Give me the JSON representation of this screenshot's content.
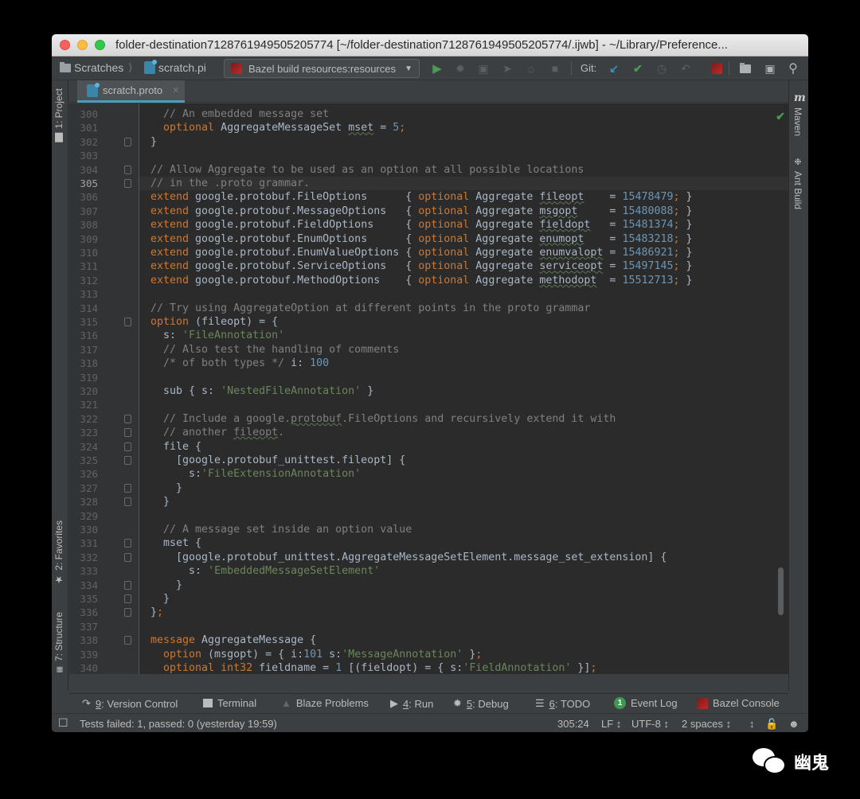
{
  "window": {
    "title": "folder-destination7128761949505205774 [~/folder-destination7128761949505205774/.ijwb] - ~/Library/Preference..."
  },
  "navbar": {
    "breadcrumb": [
      "Scratches",
      "scratch.pi"
    ],
    "run_config": "Bazel build resources:resources",
    "git_label": "Git:",
    "icons": [
      "run-icon",
      "debug-icon",
      "coverage-icon",
      "profile-icon",
      "bug-icon",
      "stop-icon",
      "git-update-icon",
      "git-commit-icon",
      "history-icon",
      "rollback-icon",
      "bazel-sync-icon",
      "project-structure-icon",
      "terminal-window-icon",
      "search-icon"
    ]
  },
  "left_tools": {
    "project": "1: Project",
    "favorites": "2: Favorites",
    "structure": "7: Structure"
  },
  "right_tools": {
    "maven": "Maven",
    "ant": "Ant Build"
  },
  "editor": {
    "tab_label": "scratch.proto",
    "current_line": 305,
    "lines": [
      {
        "n": "300",
        "fold": false
      },
      {
        "n": "301",
        "fold": false
      },
      {
        "n": "302",
        "fold": true
      },
      {
        "n": "303",
        "fold": false
      },
      {
        "n": "304",
        "fold": true
      },
      {
        "n": "305",
        "fold": true
      },
      {
        "n": "306"
      },
      {
        "n": "307"
      },
      {
        "n": "308"
      },
      {
        "n": "309"
      },
      {
        "n": "310"
      },
      {
        "n": "311"
      },
      {
        "n": "312"
      },
      {
        "n": "313"
      },
      {
        "n": "314"
      },
      {
        "n": "315"
      },
      {
        "n": "316"
      },
      {
        "n": "317"
      },
      {
        "n": "318"
      },
      {
        "n": "319"
      },
      {
        "n": "320"
      },
      {
        "n": "321"
      },
      {
        "n": "322"
      },
      {
        "n": "323"
      },
      {
        "n": "324"
      },
      {
        "n": "325"
      },
      {
        "n": "326"
      },
      {
        "n": "327"
      },
      {
        "n": "328"
      },
      {
        "n": "329"
      },
      {
        "n": "330"
      },
      {
        "n": "331"
      },
      {
        "n": "332"
      },
      {
        "n": "333"
      },
      {
        "n": "334"
      },
      {
        "n": "335"
      },
      {
        "n": "336"
      },
      {
        "n": "337"
      },
      {
        "n": "338"
      },
      {
        "n": "339"
      },
      {
        "n": "340"
      }
    ],
    "code": {
      "l300": "// An embedded message set",
      "l301_kw": "optional",
      "l301_type": " AggregateMessageSet ",
      "l301_field": "mset",
      "l301_eq": " = ",
      "l301_num": "5",
      "l302": "}",
      "l304": "// Allow Aggregate to be used as an option at all possible locations",
      "l305": "// in the .proto grammar.",
      "extends": [
        {
          "target": "google.protobuf.FileOptions      ",
          "field": "fileopt",
          "pad": "    ",
          "num": "15478479"
        },
        {
          "target": "google.protobuf.MessageOptions   ",
          "field": "msgopt",
          "pad": "     ",
          "num": "15480088"
        },
        {
          "target": "google.protobuf.FieldOptions     ",
          "field": "fieldopt",
          "pad": "   ",
          "num": "15481374"
        },
        {
          "target": "google.protobuf.EnumOptions      ",
          "field": "enumopt",
          "pad": "    ",
          "num": "15483218"
        },
        {
          "target": "google.protobuf.EnumValueOptions ",
          "field": "enumvalopt",
          "pad": " ",
          "num": "15486921"
        },
        {
          "target": "google.protobuf.ServiceOptions   ",
          "field": "serviceopt",
          "pad": " ",
          "num": "15497145"
        },
        {
          "target": "google.protobuf.MethodOptions    ",
          "field": "methodopt",
          "pad": "  ",
          "num": "15512713"
        }
      ],
      "extend_kw": "extend",
      "optional_kw": "optional",
      "aggregate": " Aggregate ",
      "l314": "// Try using AggregateOption at different points in the proto grammar",
      "l315_kw": "option",
      "l315_rest": " (fileopt) = {",
      "l316_key": "  s: ",
      "l316_str": "'FileAnnotation'",
      "l317": "  // Also test the handling of comments",
      "l318_c": "  /* of both types */",
      "l318_key": " i: ",
      "l318_num": "100",
      "l320_pre": "  sub { s: ",
      "l320_str": "'NestedFileAnnotation'",
      "l320_post": " }",
      "l322_a": "  // Include a google.",
      "l322_u": "protobuf",
      "l322_b": ".FileOptions and recursively extend it with",
      "l323_a": "  // another ",
      "l323_u": "fileopt",
      "l323_b": ".",
      "l324": "  file {",
      "l325": "    [google.protobuf_unittest.fileopt] {",
      "l326_key": "      s:",
      "l326_str": "'FileExtensionAnnotation'",
      "l327": "    }",
      "l328": "  }",
      "l330": "  // A message set inside an option value",
      "l331": "  mset {",
      "l332": "    [google.protobuf_unittest.AggregateMessageSetElement.message_set_extension] {",
      "l333_key": "      s: ",
      "l333_str": "'EmbeddedMessageSetElement'",
      "l334": "    }",
      "l335": "  }",
      "l336": "};",
      "l338_kw": "message",
      "l338_rest": " AggregateMessage {",
      "l339_kw": "  option",
      "l339_a": " (msgopt) = { i:",
      "l339_num": "101",
      "l339_b": " s:",
      "l339_str": "'MessageAnnotation'",
      "l339_c": " };",
      "l340_kw": "  optional",
      "l340_kw2": " int32",
      "l340_a": " fieldname = ",
      "l340_num": "1",
      "l340_b": " [(fieldopt) = { s:",
      "l340_str": "'FieldAnnotation'",
      "l340_c": " }];"
    }
  },
  "bottom_tools": [
    {
      "key": "9",
      "label": ": Version Control"
    },
    {
      "key": "",
      "label": "Terminal"
    },
    {
      "key": "",
      "label": "Blaze Problems"
    },
    {
      "key": "4",
      "label": ": Run"
    },
    {
      "key": "5",
      "label": ": Debug"
    },
    {
      "key": "6",
      "label": ": TODO"
    },
    {
      "key": "",
      "label": "Event Log",
      "badge": "1"
    },
    {
      "key": "",
      "label": "Bazel Console"
    }
  ],
  "status": {
    "message": "Tests failed: 1, passed: 0 (yesterday 19:59)",
    "position": "305:24",
    "line_sep": "LF ↕",
    "encoding": "UTF-8 ↕",
    "indent": "2 spaces ↕",
    "extra": "↕"
  },
  "watermark": {
    "text": "幽鬼"
  },
  "colors": {
    "keyword": "#cc7832",
    "comment": "#808080",
    "number": "#6897bb",
    "string": "#6a8759",
    "accent": "#4a9bbd"
  }
}
